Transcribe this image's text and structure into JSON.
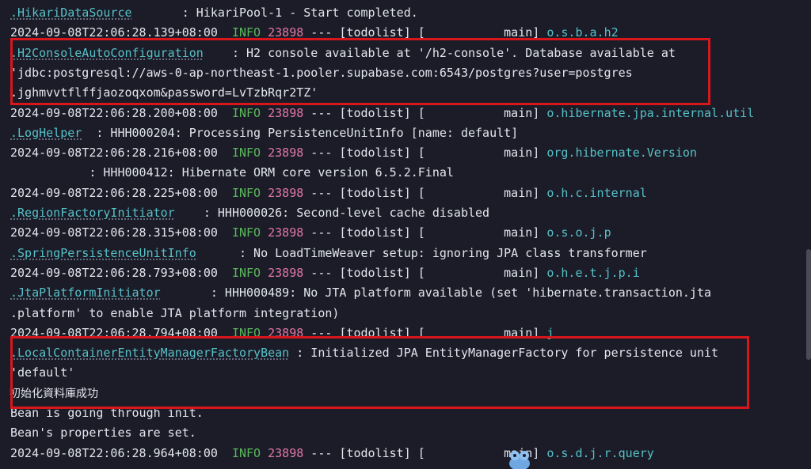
{
  "terminal": {
    "colors": {
      "background": "#1b1c27",
      "text": "#e4e6ee",
      "class": "#56c1c9",
      "level": "#5ab85c",
      "pid": "#e277a6",
      "highlight": "#d8161c"
    },
    "lines": [
      {
        "kind": "cont",
        "cls": ".HikariDataSource",
        "msg": "       : HikariPool-1 - Start completed."
      },
      {
        "kind": "head",
        "ts": "2024-09-08T22:06:28.139+08:00",
        "lvl": "INFO",
        "pid": "23898",
        "sep": " --- [todolist] [           main] ",
        "lg": "o.s.b.a.h2"
      },
      {
        "kind": "cont",
        "cls": ".H2ConsoleAutoConfiguration",
        "msg": "    : H2 console available at '/h2-console'. Database available at"
      },
      {
        "kind": "text",
        "text": "'jdbc:postgresql://aws-0-ap-northeast-1.pooler.supabase.com:6543/postgres?user=postgres"
      },
      {
        "kind": "text",
        "text": ".jghmvvtflffjaozoqxom&password=LvTzbRqr2TZ'"
      },
      {
        "kind": "head",
        "ts": "2024-09-08T22:06:28.200+08:00",
        "lvl": "INFO",
        "pid": "23898",
        "sep": " --- [todolist] [           main] ",
        "lg": "o.hibernate.jpa.internal.util"
      },
      {
        "kind": "cont",
        "cls": ".LogHelper",
        "msg": "  : HHH000204: Processing PersistenceUnitInfo [name: default]"
      },
      {
        "kind": "head",
        "ts": "2024-09-08T22:06:28.216+08:00",
        "lvl": "INFO",
        "pid": "23898",
        "sep": " --- [todolist] [           main] ",
        "lg": "org.hibernate.Version"
      },
      {
        "kind": "text",
        "text": "           : HHH000412: Hibernate ORM core version 6.5.2.Final"
      },
      {
        "kind": "head",
        "ts": "2024-09-08T22:06:28.225+08:00",
        "lvl": "INFO",
        "pid": "23898",
        "sep": " --- [todolist] [           main] ",
        "lg": "o.h.c.internal"
      },
      {
        "kind": "cont",
        "cls": ".RegionFactoryInitiator",
        "msg": "    : HHH000026: Second-level cache disabled"
      },
      {
        "kind": "head",
        "ts": "2024-09-08T22:06:28.315+08:00",
        "lvl": "INFO",
        "pid": "23898",
        "sep": " --- [todolist] [           main] ",
        "lg": "o.s.o.j.p"
      },
      {
        "kind": "cont",
        "cls": ".SpringPersistenceUnitInfo",
        "msg": "      : No LoadTimeWeaver setup: ignoring JPA class transformer"
      },
      {
        "kind": "head",
        "ts": "2024-09-08T22:06:28.793+08:00",
        "lvl": "INFO",
        "pid": "23898",
        "sep": " --- [todolist] [           main] ",
        "lg": "o.h.e.t.j.p.i"
      },
      {
        "kind": "cont",
        "cls": ".JtaPlatformInitiator",
        "msg": "       : HHH000489: No JTA platform available (set 'hibernate.transaction.jta"
      },
      {
        "kind": "text",
        "text": ".platform' to enable JTA platform integration)"
      },
      {
        "kind": "head",
        "ts": "2024-09-08T22:06:28.794+08:00",
        "lvl": "INFO",
        "pid": "23898",
        "sep": " --- [todolist] [           main] ",
        "lg": "j"
      },
      {
        "kind": "cont",
        "cls": ".LocalContainerEntityManagerFactoryBean",
        "msg": " : Initialized JPA EntityManagerFactory for persistence unit"
      },
      {
        "kind": "text",
        "text": "'default'"
      },
      {
        "kind": "cjk",
        "text": "初始化資料庫成功"
      },
      {
        "kind": "text",
        "text": "Bean is going through init."
      },
      {
        "kind": "text",
        "text": "Bean's properties are set."
      },
      {
        "kind": "head",
        "ts": "2024-09-08T22:06:28.964+08:00",
        "lvl": "INFO",
        "pid": "23898",
        "sep": " --- [todolist] [           main] ",
        "lg": "o.s.d.j.r.query"
      }
    ]
  }
}
